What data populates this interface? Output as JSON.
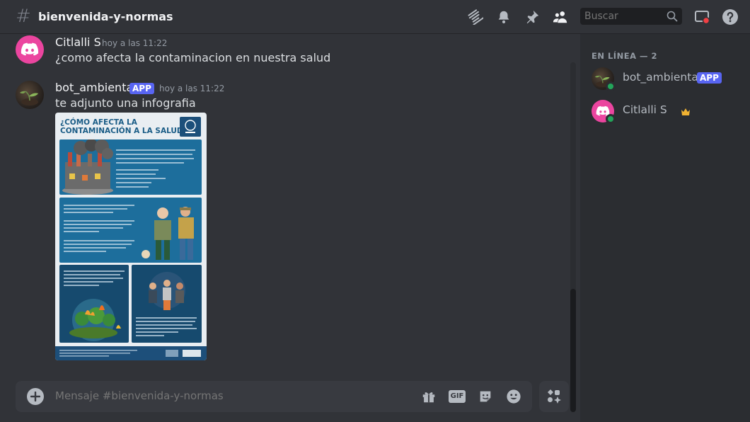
{
  "header": {
    "channel_name": "bienvenida-y-normas",
    "search_placeholder": "Buscar"
  },
  "messages": [
    {
      "author": "Citlalli S",
      "timestamp": "hoy a las 11:22",
      "text": "¿como afecta la contaminacion en nuestra salud"
    },
    {
      "author": "bot_ambiental",
      "tag": "APP",
      "timestamp": "hoy a las 11:22",
      "text": "te adjunto una infografia",
      "attachment": {
        "title_line1": "¿CÓMO AFECTA LA",
        "title_line2": "CONTAMINACIÓN A LA SALUD?"
      }
    }
  ],
  "composer": {
    "placeholder": "Mensaje #bienvenida-y-normas",
    "gif_label": "GIF"
  },
  "members": {
    "header": "EN LÍNEA — 2",
    "list": [
      {
        "name": "bot_ambiental",
        "tag": "APP",
        "status": "online"
      },
      {
        "name": "Citlalli S",
        "badge": "crown-icon",
        "status": "online"
      }
    ]
  },
  "colors": {
    "accent": "#5865f2",
    "online": "#23a55a",
    "discord_avatar": "#eb459f",
    "crown": "#f0b232"
  }
}
